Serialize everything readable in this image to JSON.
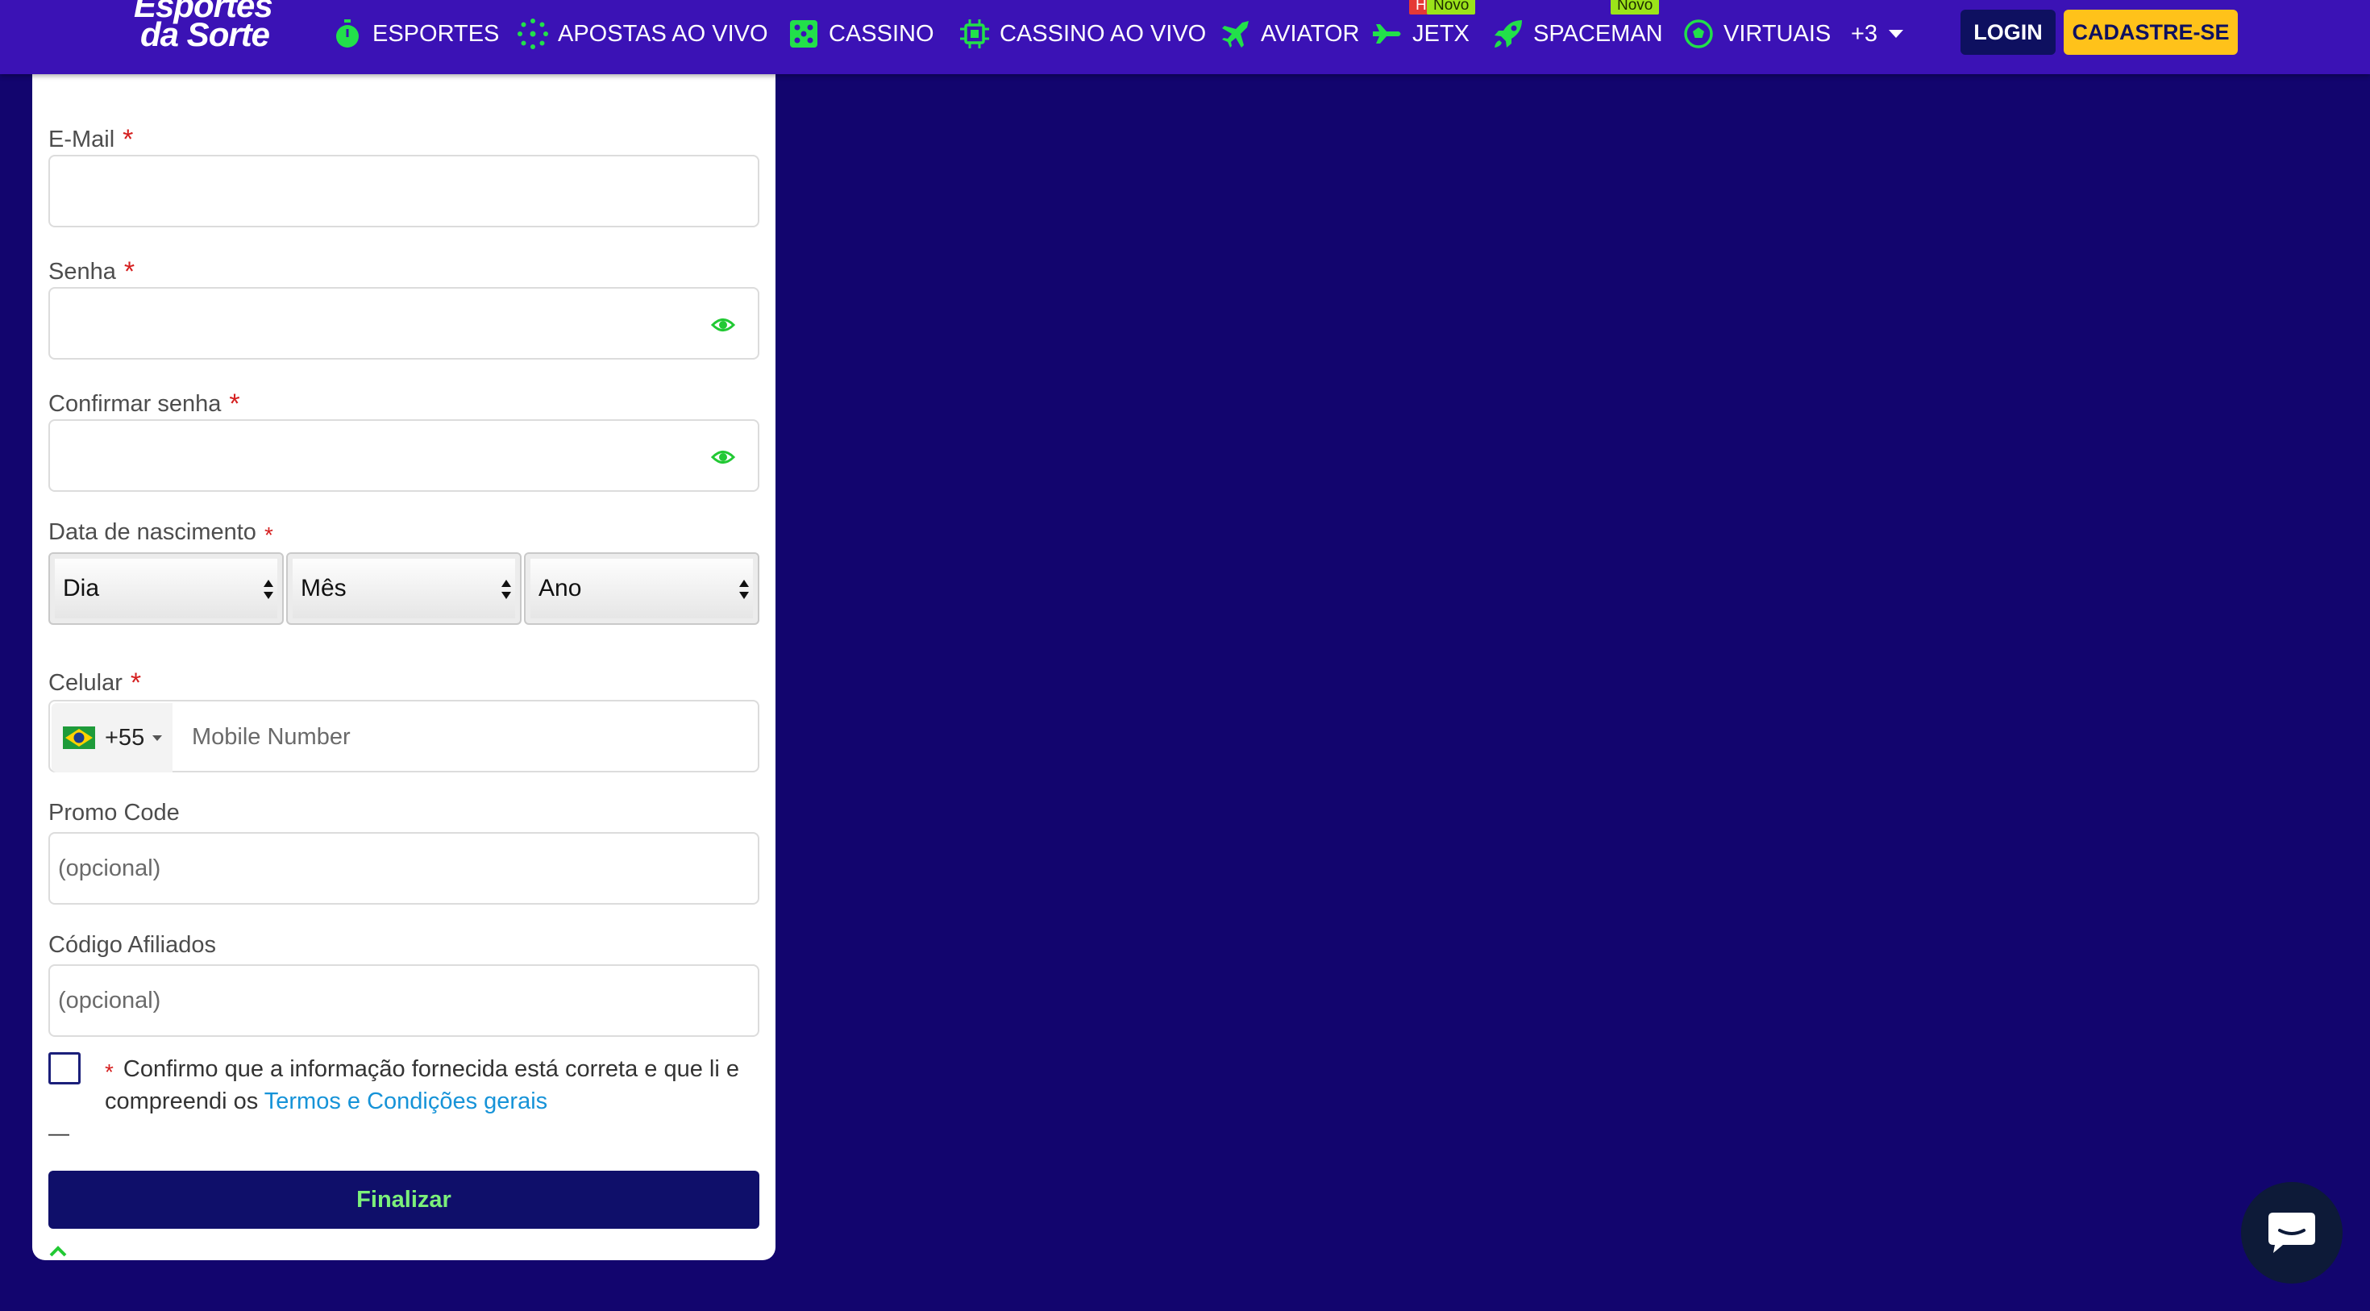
{
  "header": {
    "logo_line1": "Esportes",
    "logo_line2": "da Sorte",
    "nav": [
      {
        "label": "ESPORTES",
        "icon": "stopwatch-icon"
      },
      {
        "label": "APOSTAS AO VIVO",
        "icon": "live-burst-icon"
      },
      {
        "label": "CASSINO",
        "icon": "dice-icon"
      },
      {
        "label": "CASSINO AO VIVO",
        "icon": "chip-icon"
      },
      {
        "label": "AVIATOR",
        "icon": "airplane-icon",
        "badge": "Hot"
      },
      {
        "label": "JETX",
        "icon": "jet-icon",
        "badge": "Novo"
      },
      {
        "label": "SPACEMAN",
        "icon": "rocket-icon",
        "badge": "Novo"
      },
      {
        "label": "VIRTUAIS",
        "icon": "soccer-ball-icon"
      }
    ],
    "more_label": "+3",
    "login_label": "LOGIN",
    "signup_label": "CADASTRE-SE"
  },
  "form": {
    "email_label": "E-Mail",
    "password_label": "Senha",
    "confirm_password_label": "Confirmar senha",
    "birthdate_label": "Data de nascimento",
    "day_select": "Dia",
    "month_select": "Mês",
    "year_select": "Ano",
    "phone_label": "Celular",
    "phone_prefix": "+55",
    "phone_placeholder": "Mobile Number",
    "promo_label": "Promo Code",
    "promo_placeholder": "(opcional)",
    "affiliate_label": "Código Afiliados",
    "affiliate_placeholder": "(opcional)",
    "required_mark": "*",
    "terms_text": "Confirmo que a informação fornecida está correta e que li e compreendi os",
    "terms_link": "Termos e Condições gerais",
    "dash": "—",
    "submit_label": "Finalizar"
  },
  "colors": {
    "page_bg": "#12056e",
    "header_bg": "#3b12b5",
    "nav_icon": "#22e04a",
    "login_bg": "#0e1060",
    "signup_bg": "#ffc21a",
    "submit_bg": "#0f0f6a",
    "submit_text": "#7cf07a",
    "required": "#d51f1f",
    "link": "#1693d8"
  }
}
